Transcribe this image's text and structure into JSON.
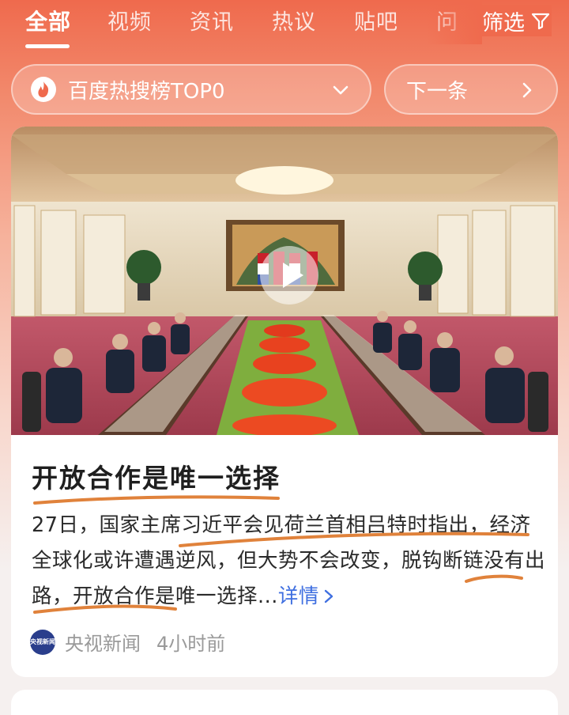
{
  "tabs": [
    {
      "label": "全部",
      "active": true
    },
    {
      "label": "视频"
    },
    {
      "label": "资讯"
    },
    {
      "label": "热议"
    },
    {
      "label": "贴吧"
    },
    {
      "label": "问"
    }
  ],
  "filter": {
    "label": "筛选",
    "icon": "filter-icon"
  },
  "hot_pill": {
    "label": "百度热搜榜TOP0",
    "icon": "flame-icon",
    "chevron": "chevron-down-icon"
  },
  "next_pill": {
    "label": "下一条",
    "chevron": "chevron-right-icon"
  },
  "article": {
    "image": "meeting-room-photo",
    "play_icon": "play-icon",
    "headline": "开放合作是唯一选择",
    "body": "27日，国家主席习近平会见荷兰首相吕特时指出，经济全球化或许遭遇逆风，但大势不会改变，脱钩断链没有出路，开放合作是唯一选择...",
    "detail_label": "详情",
    "source_logo": "央视新闻",
    "source": "央视新闻",
    "time": "4小时前"
  },
  "colors": {
    "accent_top": "#ef6a4d",
    "link": "#3f6fe0",
    "ink_marks": "#e0823b"
  }
}
